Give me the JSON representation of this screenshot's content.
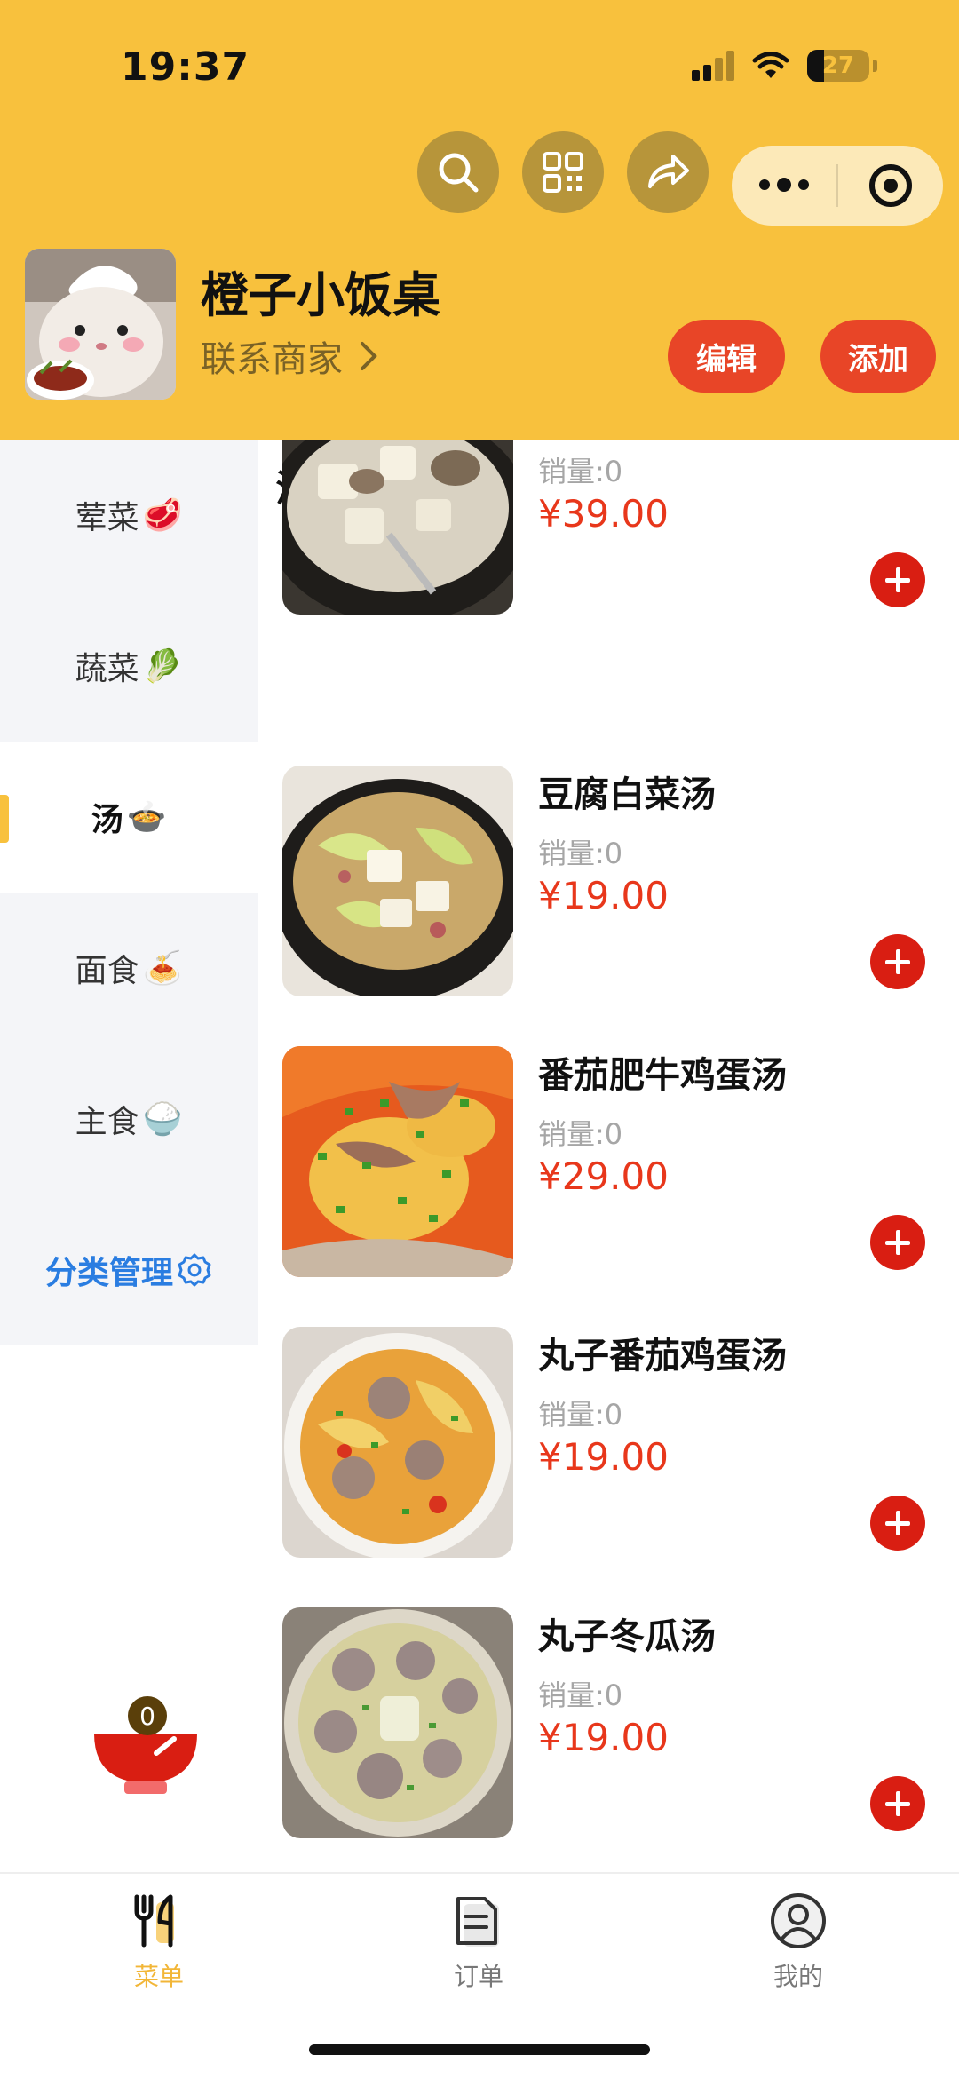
{
  "status_bar": {
    "time": "19:37",
    "battery": "27"
  },
  "shop": {
    "name": "橙子小饭桌",
    "contact": "联系商家"
  },
  "header_actions": {
    "edit_label": "编辑",
    "add_label": "添加"
  },
  "categories": [
    {
      "label": "荤菜",
      "emoji": "🥩",
      "active": false
    },
    {
      "label": "蔬菜",
      "emoji": "🥬",
      "active": false
    },
    {
      "label": "汤",
      "emoji": "🍲",
      "active": true
    },
    {
      "label": "面食",
      "emoji": "🍝",
      "active": false
    },
    {
      "label": "主食",
      "emoji": "🍚",
      "active": false
    }
  ],
  "category_manage_label": "分类管理",
  "section": {
    "title": "汤",
    "emoji": "🍲"
  },
  "dishes": [
    {
      "name": "",
      "sales": "销量:0",
      "price": "¥39.00"
    },
    {
      "name": "豆腐白菜汤",
      "sales": "销量:0",
      "price": "¥19.00"
    },
    {
      "name": "番茄肥牛鸡蛋汤",
      "sales": "销量:0",
      "price": "¥29.00"
    },
    {
      "name": "丸子番茄鸡蛋汤",
      "sales": "销量:0",
      "price": "¥19.00"
    },
    {
      "name": "丸子冬瓜汤",
      "sales": "销量:0",
      "price": "¥19.00"
    }
  ],
  "cart": {
    "count": "0"
  },
  "tabbar": [
    {
      "label": "菜单",
      "icon": "fork-knife-icon",
      "active": true
    },
    {
      "label": "订单",
      "icon": "order-document-icon",
      "active": false
    },
    {
      "label": "我的",
      "icon": "profile-icon",
      "active": false
    }
  ],
  "colors": {
    "brand_yellow": "#F8C13D",
    "accent_red": "#E84527",
    "price_red": "#E8371B",
    "link_blue": "#2A7DE1"
  }
}
